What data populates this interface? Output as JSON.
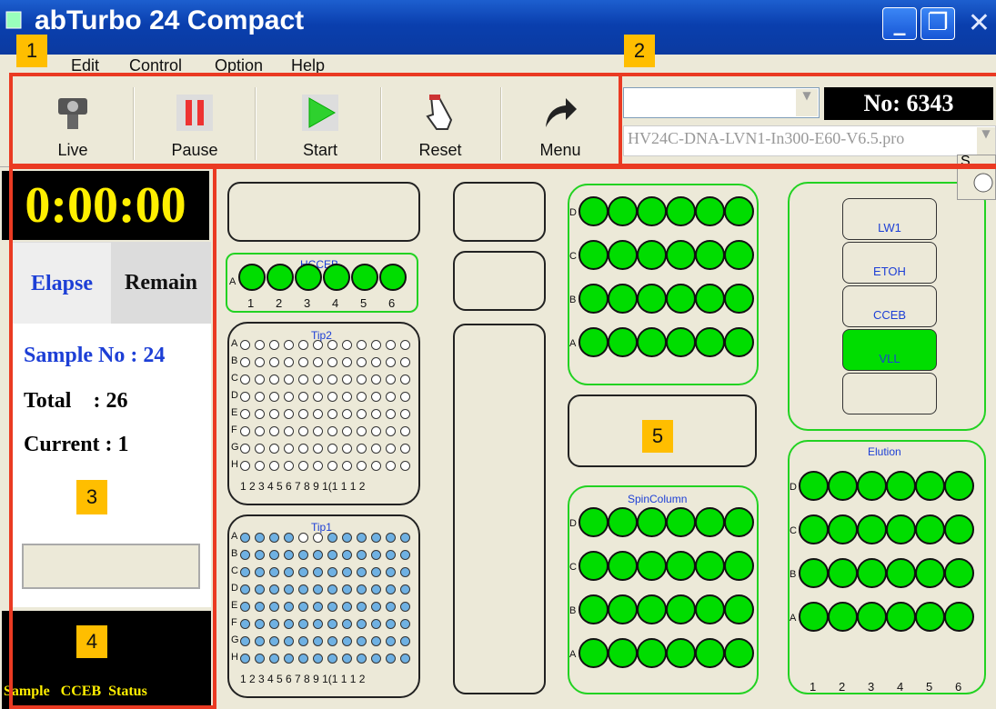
{
  "window": {
    "title": "LabTurbo 24 Compact",
    "title_shown": "abTurbo 24 Compact"
  },
  "menu": {
    "items": [
      "Edit",
      "Control",
      "Option",
      "Help"
    ]
  },
  "toolbar": {
    "live": "Live",
    "pause": "Pause",
    "start": "Start",
    "reset": "Reset",
    "menu": "Menu"
  },
  "header": {
    "no": "No: 6343",
    "profile": "HV24C-DNA-LVN1-In300-E60-V6.5.pro",
    "cursor_char": "S"
  },
  "timer": {
    "clock": "0:00:00",
    "elapse_tab": "Elapse",
    "remain_tab": "Remain"
  },
  "info": {
    "sample": "Sample No : 24",
    "total": "Total    : 26",
    "current": "Current : 1"
  },
  "status": {
    "label": "Sample   CCEB  Status"
  },
  "workspace": {
    "hcceb_label": "HCCEB",
    "hcceb_row": "A",
    "tip2_label": "Tip2",
    "tip1_label": "Tip1",
    "tip_rows": [
      "A",
      "B",
      "C",
      "D",
      "E",
      "F",
      "G",
      "H"
    ],
    "tip_cols": "1 2 3 4 5 6 7 8 9 10 11 12",
    "tip_cols_shown": "1 2 3 4 5 6 7 8 9 1(1 1 1 2",
    "well_rows": [
      "D",
      "C",
      "B",
      "A"
    ],
    "well_cols": [
      "1",
      "2",
      "3",
      "4",
      "5",
      "6"
    ],
    "spincolumn_label": "SpinColumn",
    "elution_label": "Elution",
    "reagents": [
      "LW1",
      "ETOH",
      "CCEB",
      "VLL",
      ""
    ],
    "active_reagent": "VLL"
  },
  "annotations": [
    "1",
    "2",
    "3",
    "4",
    "5"
  ],
  "colors": {
    "accent_red": "#ea3a22",
    "tag_yellow": "#ffbe00",
    "well_green": "#00dd00",
    "titlebar_blue": "#0a3fae"
  }
}
